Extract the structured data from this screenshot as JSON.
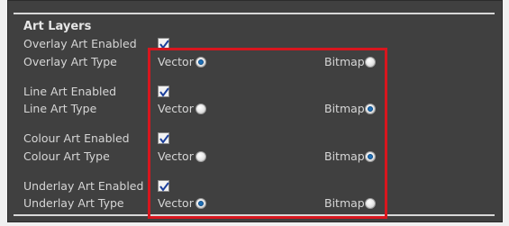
{
  "section": {
    "title": "Art Layers"
  },
  "rows": [
    {
      "enabled_label": "Overlay Art Enabled",
      "type_label": "Overlay Art Type",
      "enabled": true,
      "selected": "vector"
    },
    {
      "enabled_label": "Line Art Enabled",
      "type_label": "Line Art Type",
      "enabled": true,
      "selected": "bitmap"
    },
    {
      "enabled_label": "Colour Art Enabled",
      "type_label": "Colour Art Type",
      "enabled": true,
      "selected": "bitmap"
    },
    {
      "enabled_label": "Underlay Art Enabled",
      "type_label": "Underlay Art Type",
      "enabled": true,
      "selected": "vector"
    }
  ],
  "options": {
    "vector": "Vector",
    "bitmap": "Bitmap"
  },
  "colors": {
    "highlight": "#d8161e",
    "panel_bg": "#404040",
    "radio_selected": "#1f6fb5"
  }
}
